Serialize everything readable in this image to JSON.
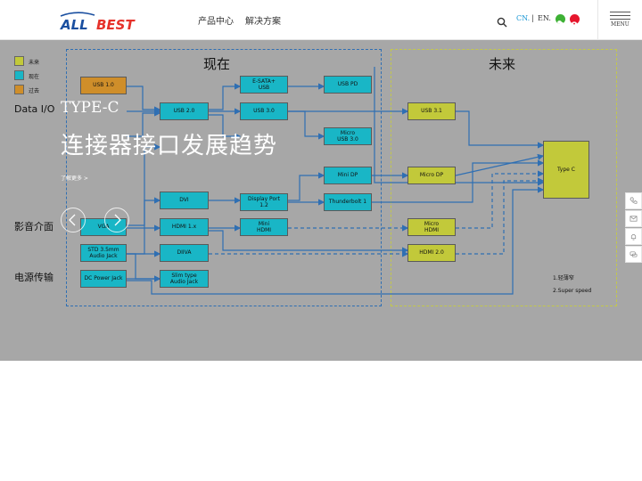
{
  "header": {
    "logo_text": "ALL BEST",
    "nav": [
      "产品中心",
      "解决方案"
    ],
    "lang_cn": "CN.",
    "lang_sep": "|",
    "lang_en": "EN.",
    "menu_label": "MENU",
    "icons": [
      "search-icon",
      "wechat-icon",
      "weibo-icon",
      "hamburger-menu-icon"
    ]
  },
  "colors": {
    "accent": "#1a97d5",
    "present_box": "#19b6c6",
    "future_box": "#c2c93a",
    "past_box": "#cf8e2a",
    "wire": "#2f6fb3",
    "banner_bg": "#a7a7a7"
  },
  "diagram": {
    "section_now": "现在",
    "section_future": "未来",
    "legend": [
      "未来",
      "现在",
      "过去"
    ],
    "categories": [
      "Data I/O",
      "影音介面",
      "电源传输"
    ],
    "boxes": {
      "usb10": "USB 1.0",
      "usb20": "USB 2.0",
      "esata": "E-SATA+\nUSB",
      "usb30": "USB 3.0",
      "usbpd": "USB PD",
      "microusb30": "Micro\nUSB 3.0",
      "minidp": "Mini DP",
      "thunderbolt": "Thunderbolt 1",
      "dvi": "DVI",
      "displayport": "Display Port\n1.2",
      "vga": "VGA",
      "hdmi1x": "HDMI 1.x",
      "minihdmi": "Mini\nHDMI",
      "std35": "STD 3.5mm\nAudio Jack",
      "diiva": "DIIVA",
      "dcpower": "DC Power Jack",
      "slimtype": "Slim type\nAudio Jack",
      "usb31": "USB 3.1",
      "microdp": "Micro DP",
      "typec": "Type C",
      "microhdmi": "Micro\nHDMI",
      "hdmi20": "HDMI 2.0"
    },
    "notes": [
      "1.轻薄窄",
      "2.Super speed"
    ]
  },
  "hero": {
    "title_en": "TYPE-C",
    "title_cn": "连接器接口发展趋势",
    "more_link": "了解更多 >"
  },
  "slider_controls": [
    "chevron-left-icon",
    "chevron-right-icon"
  ],
  "side_toolbar": [
    "phone-icon",
    "mail-icon",
    "bell-icon",
    "chat-icon"
  ]
}
